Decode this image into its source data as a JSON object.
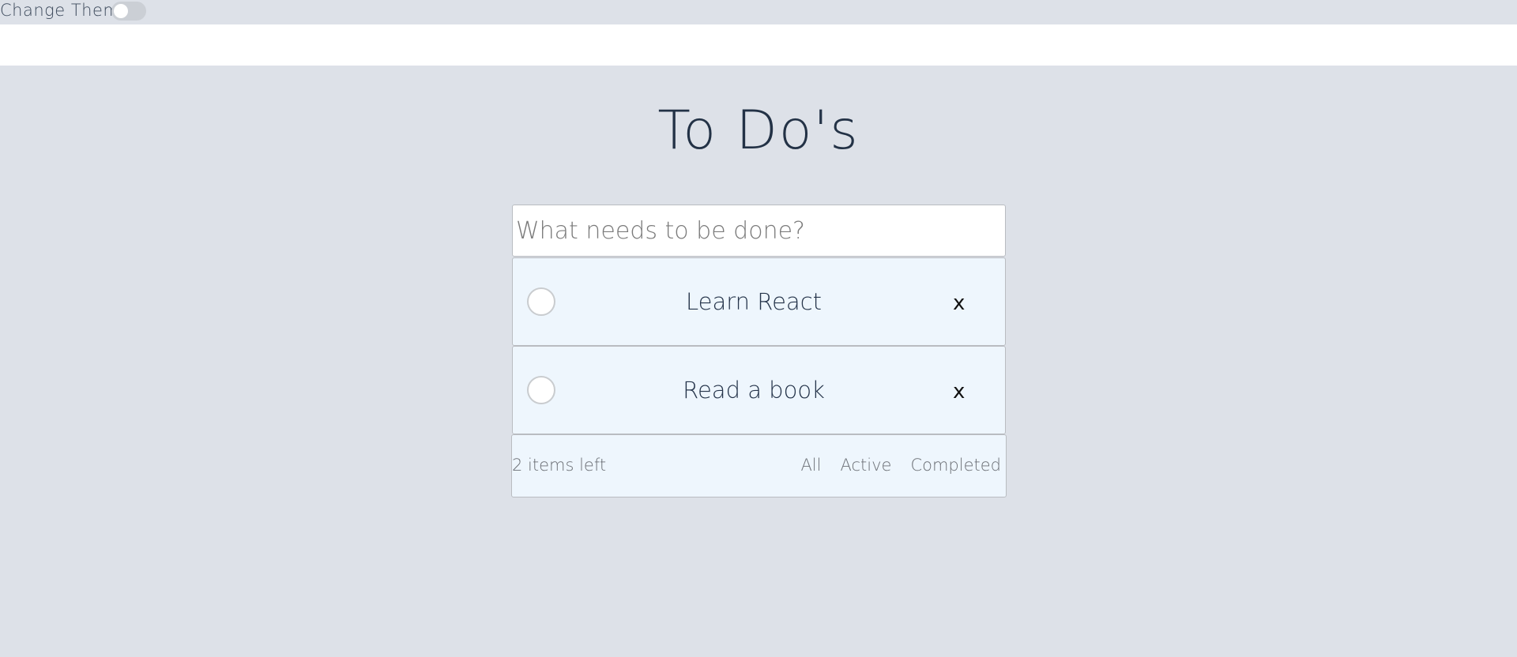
{
  "header": {
    "theme_label": "Change Theme",
    "theme_toggle_on": false
  },
  "main": {
    "title": "To Do's",
    "input_placeholder": "What needs to be done?",
    "input_value": "",
    "todos": [
      {
        "text": "Learn React",
        "delete_label": "x",
        "completed": false
      },
      {
        "text": "Read a book",
        "delete_label": "x",
        "completed": false
      }
    ]
  },
  "footer": {
    "items_left": "2 items left",
    "filters": [
      "All",
      "Active",
      "Completed"
    ]
  },
  "colors": {
    "background": "#dde1e8",
    "item_background": "#eef6fd",
    "text": "#25344a"
  }
}
